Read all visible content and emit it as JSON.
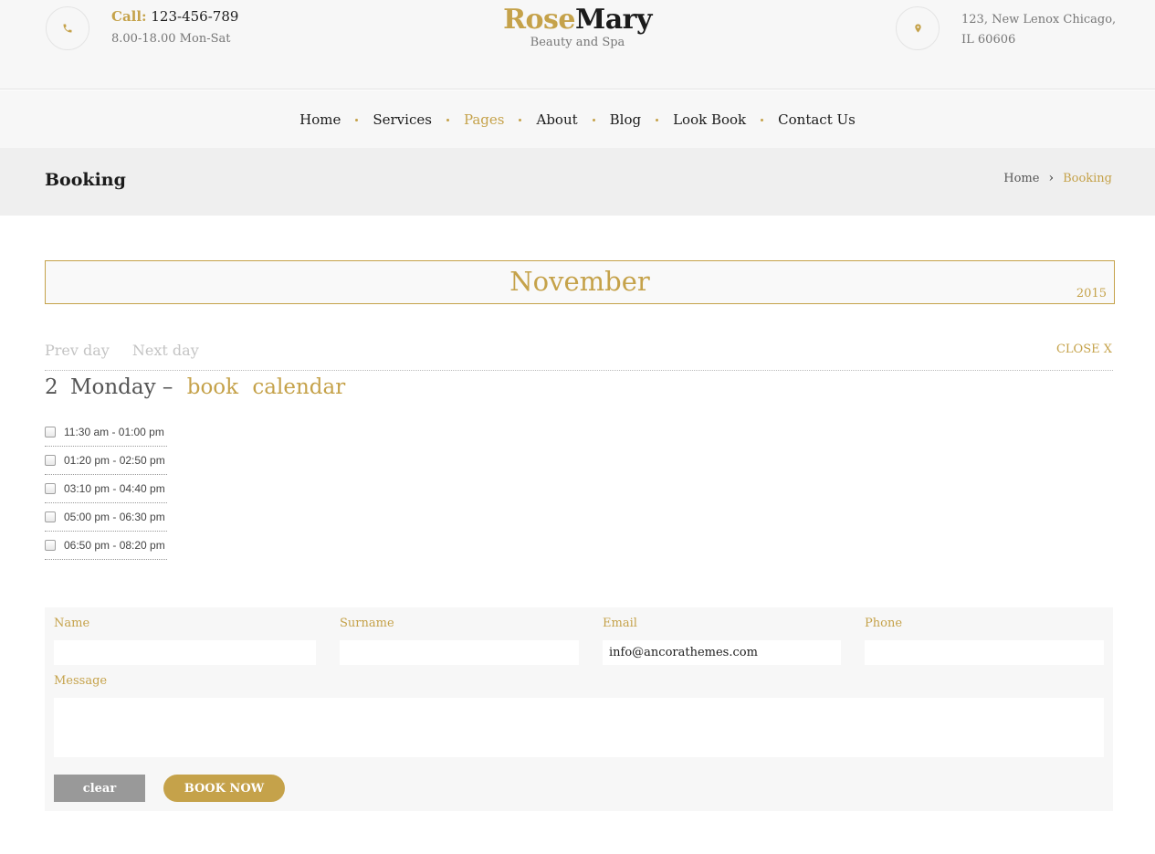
{
  "header": {
    "call_label": "Call:",
    "phone": "123-456-789",
    "hours": "8.00-18.00 Mon-Sat",
    "logo_part1": "Rose",
    "logo_part2": "Mary",
    "tagline": "Beauty and Spa",
    "address_line1": "123, New Lenox Chicago,",
    "address_line2": "IL 60606",
    "phone_icon": "phone-icon",
    "location_icon": "map-pin-icon"
  },
  "nav": {
    "items": [
      {
        "label": "Home"
      },
      {
        "label": "Services"
      },
      {
        "label": "Pages"
      },
      {
        "label": "About"
      },
      {
        "label": "Blog"
      },
      {
        "label": "Look Book"
      },
      {
        "label": "Contact Us"
      }
    ],
    "active": "Pages"
  },
  "page": {
    "title": "Booking",
    "breadcrumb": {
      "home": "Home",
      "separator": "›",
      "current": "Booking"
    }
  },
  "calendar": {
    "month": "November",
    "year": "2015",
    "prev_day": "Prev day",
    "next_day": "Next day",
    "close": "CLOSE X",
    "day_number": "2",
    "weekday": "Monday",
    "dash": "–",
    "book_word": "book",
    "calendar_word": "calendar",
    "slots": [
      {
        "label": "11:30 am - 01:00 pm",
        "checked": false
      },
      {
        "label": "01:20 pm - 02:50 pm",
        "checked": false
      },
      {
        "label": "03:10 pm - 04:40 pm",
        "checked": false
      },
      {
        "label": "05:00 pm - 06:30 pm",
        "checked": false
      },
      {
        "label": "06:50 pm - 08:20 pm",
        "checked": false
      }
    ]
  },
  "form": {
    "name_label": "Name",
    "name_value": "",
    "surname_label": "Surname",
    "surname_value": "",
    "email_label": "Email",
    "email_value": "info@ancorathemes.com",
    "phone_label": "Phone",
    "phone_value": "",
    "message_label": "Message",
    "message_value": "",
    "clear_button": "clear",
    "book_button": "BOOK NOW"
  },
  "colors": {
    "accent": "#c5a24a",
    "text_dark": "#1b1b1b",
    "muted": "#777777",
    "band": "#efefef",
    "clear_button": "#999999"
  }
}
